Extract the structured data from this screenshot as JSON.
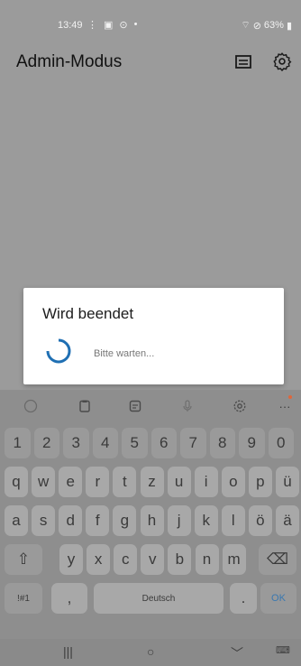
{
  "status": {
    "time": "13:49",
    "battery": "63%"
  },
  "appbar": {
    "title": "Admin-Modus",
    "screen_icon": "screen-icon",
    "settings_icon": "gear-icon"
  },
  "dialog": {
    "title": "Wird beendet",
    "message": "Bitte warten..."
  },
  "keyboard": {
    "toolbar": [
      "emoji-icon",
      "clipboard-icon",
      "text-edit-icon",
      "microphone-icon",
      "gear-icon",
      "more-icon"
    ],
    "more_label": "···",
    "row_numbers": [
      "1",
      "2",
      "3",
      "4",
      "5",
      "6",
      "7",
      "8",
      "9",
      "0"
    ],
    "row_1": [
      "q",
      "w",
      "e",
      "r",
      "t",
      "z",
      "u",
      "i",
      "o",
      "p",
      "ü"
    ],
    "row_2": [
      "a",
      "s",
      "d",
      "f",
      "g",
      "h",
      "j",
      "k",
      "l",
      "ö",
      "ä"
    ],
    "row_3": [
      "y",
      "x",
      "c",
      "v",
      "b",
      "n",
      "m"
    ],
    "shift_glyph": "⇧",
    "backspace_glyph": "⌫",
    "symbols_label": "!#1",
    "comma_label": ",",
    "space_label": "Deutsch",
    "period_label": ".",
    "enter_label": "OK"
  },
  "nav": {
    "recents": "|||",
    "home": "○",
    "back": "﹀",
    "keyboard": "⌨"
  },
  "colors": {
    "scrim": "#9b9b9b",
    "accent": "#1f6fb3",
    "ok": "#3a78b0"
  }
}
